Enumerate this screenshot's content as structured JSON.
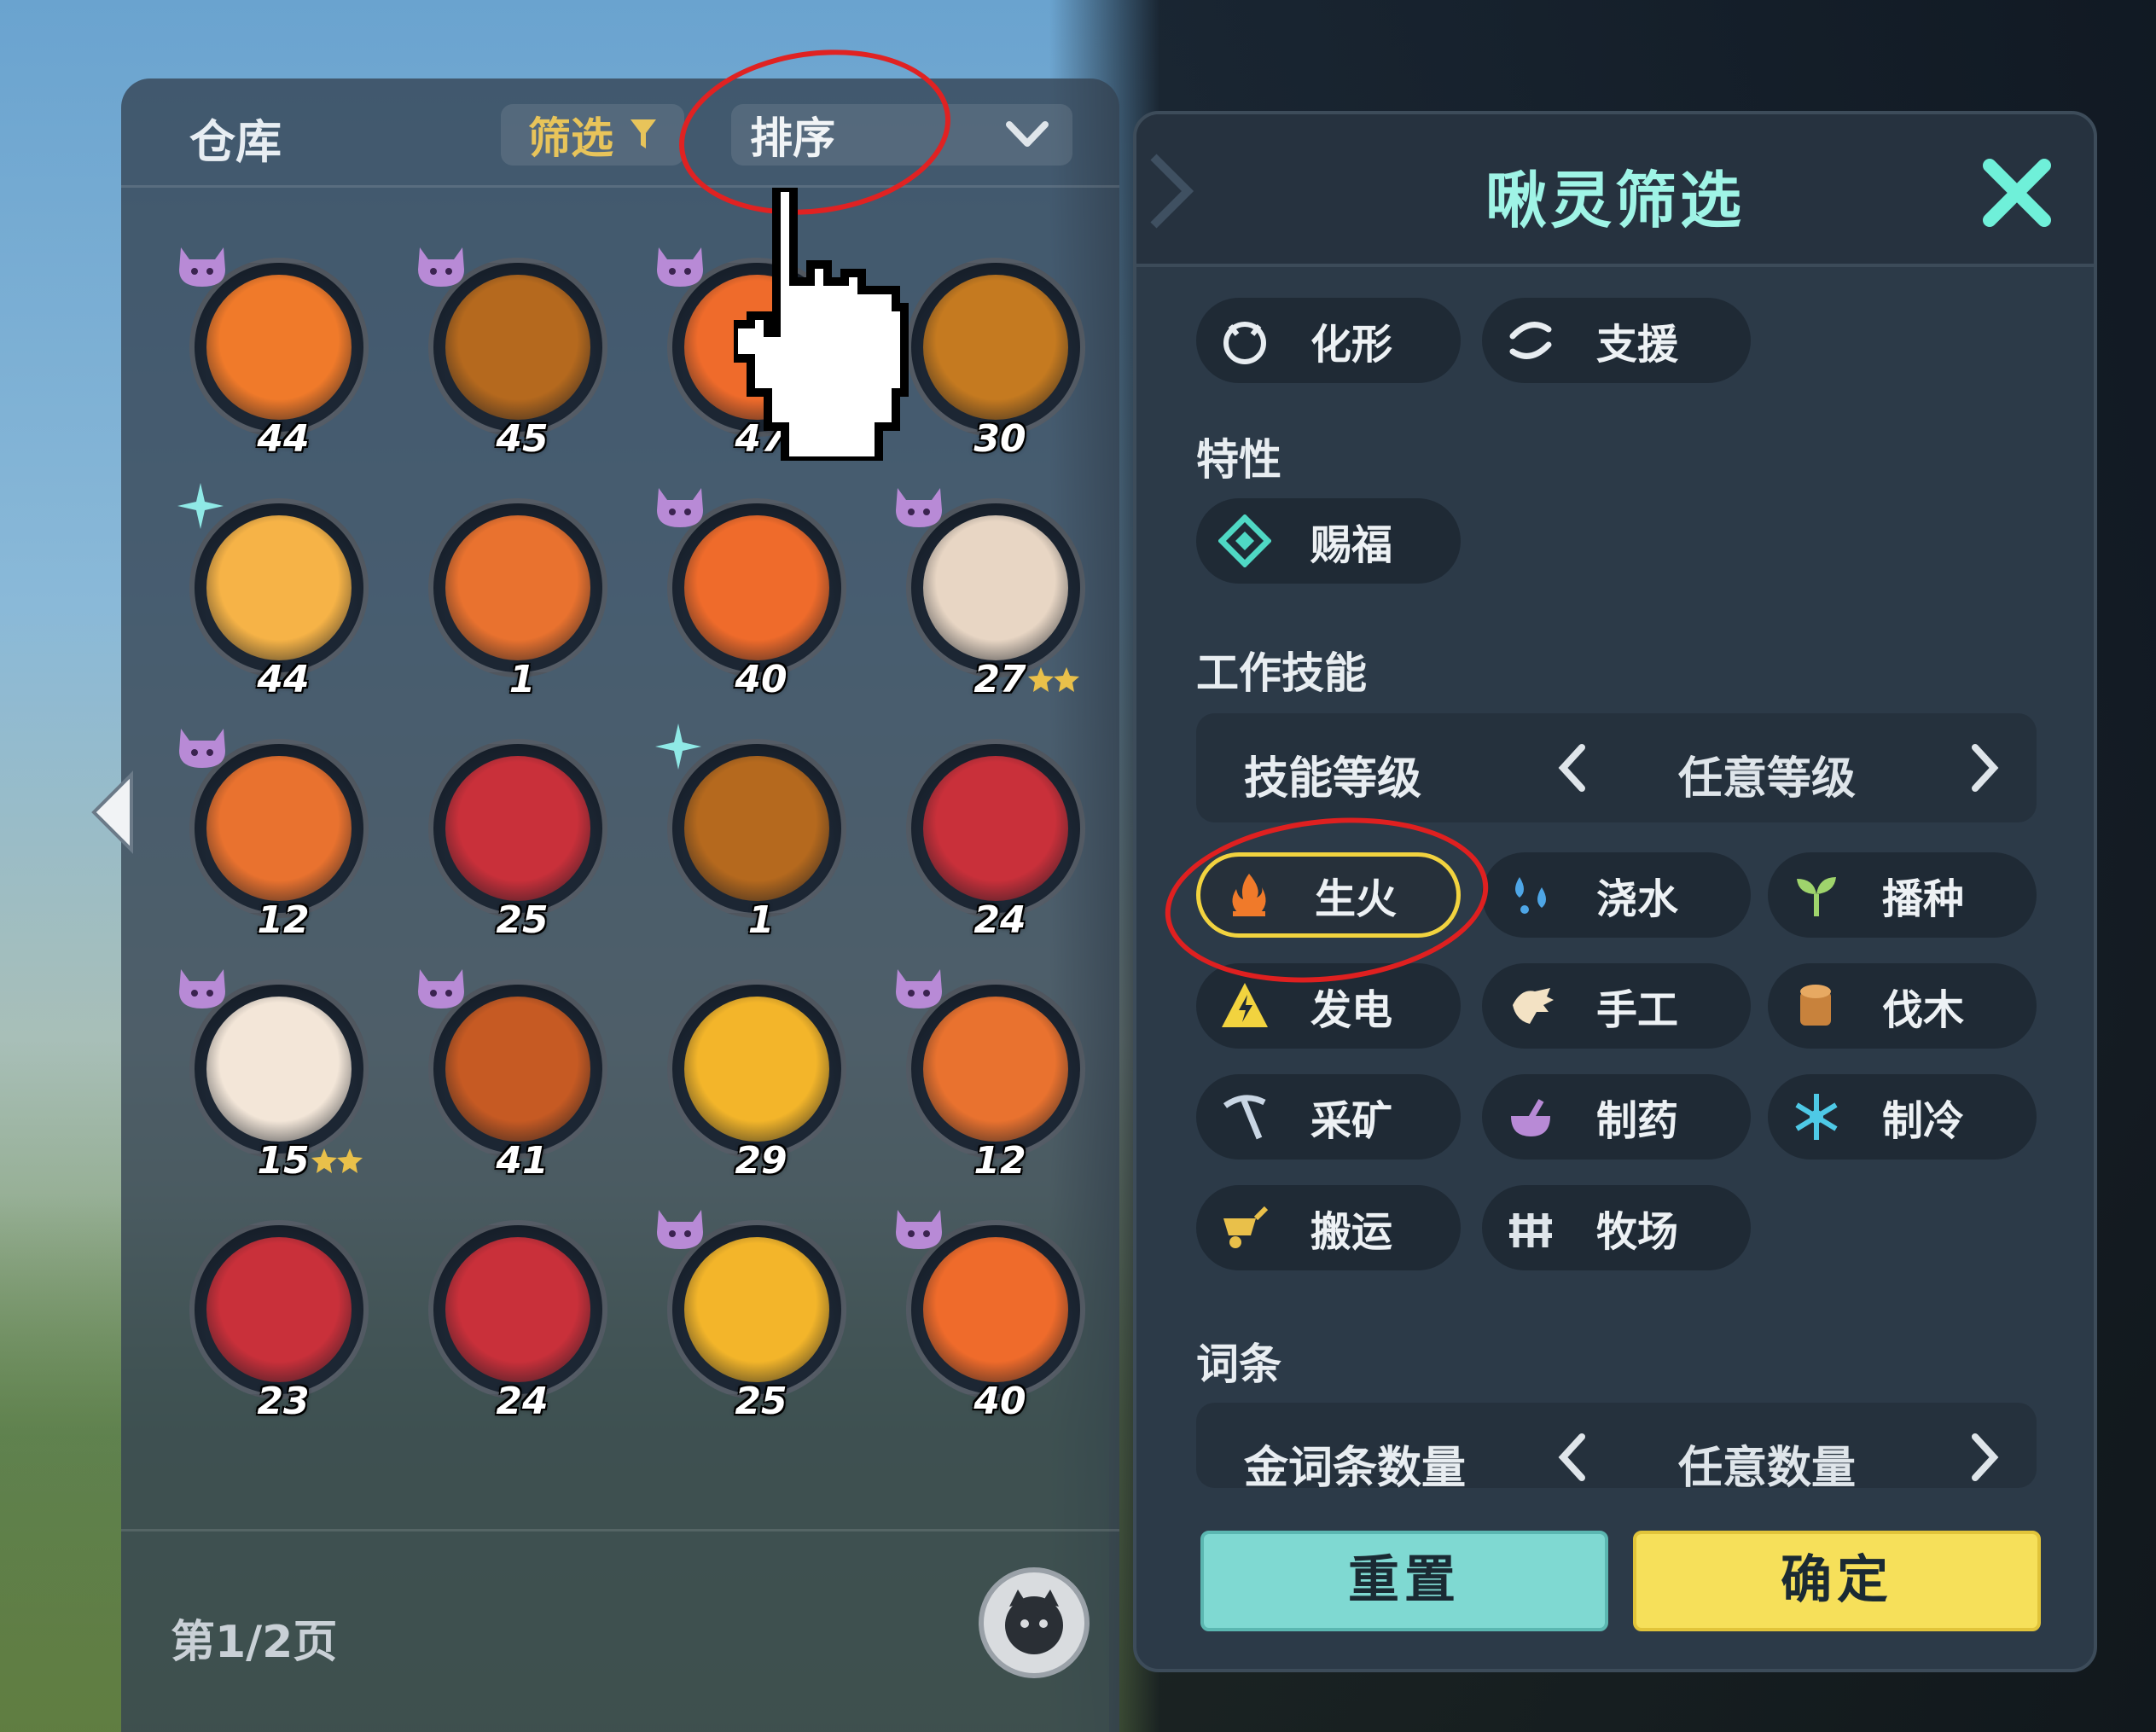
{
  "storage": {
    "title": "仓库",
    "filter_label": "筛选",
    "sort_label": "排序",
    "page_label": "第1/2页",
    "pals": [
      {
        "level": "44",
        "badge": "demon",
        "color": "#f07a2a"
      },
      {
        "level": "45",
        "badge": "demon",
        "color": "#b5691e"
      },
      {
        "level": "47",
        "badge": "demon",
        "color": "#ef6b2b",
        "stars": true
      },
      {
        "level": "30",
        "badge": "none",
        "color": "#c57a20"
      },
      {
        "level": "44",
        "badge": "spark",
        "color": "#f6b347"
      },
      {
        "level": "1",
        "badge": "none",
        "color": "#e9722f"
      },
      {
        "level": "40",
        "badge": "demon",
        "color": "#ef6b2b"
      },
      {
        "level": "27",
        "badge": "demon",
        "color": "#e8d6c4",
        "stars": true
      },
      {
        "level": "12",
        "badge": "demon",
        "color": "#e9722f"
      },
      {
        "level": "25",
        "badge": "none",
        "color": "#c9303a"
      },
      {
        "level": "1",
        "badge": "spark",
        "color": "#b5691e"
      },
      {
        "level": "24",
        "badge": "none",
        "color": "#c9303a"
      },
      {
        "level": "15",
        "badge": "demon",
        "color": "#f3e6d8",
        "stars": true
      },
      {
        "level": "41",
        "badge": "demon",
        "color": "#c65a23"
      },
      {
        "level": "29",
        "badge": "none",
        "color": "#f3b52a"
      },
      {
        "level": "12",
        "badge": "demon",
        "color": "#e9722f"
      },
      {
        "level": "23",
        "badge": "none",
        "color": "#c9303a"
      },
      {
        "level": "24",
        "badge": "none",
        "color": "#c9303a"
      },
      {
        "level": "25",
        "badge": "demon",
        "color": "#f3b52a"
      },
      {
        "level": "40",
        "badge": "demon",
        "color": "#ef6b2b"
      }
    ]
  },
  "filter_panel": {
    "title": "啾灵筛选",
    "top_chips": [
      {
        "label": "化形",
        "icon": "transform-icon"
      },
      {
        "label": "支援",
        "icon": "support-icon"
      }
    ],
    "traits_title": "特性",
    "trait_chips": [
      {
        "label": "赐福",
        "icon": "blessing-icon"
      }
    ],
    "work_title": "工作技能",
    "skill_level": {
      "label": "技能等级",
      "value": "任意等级"
    },
    "work_chips": [
      {
        "label": "生火",
        "icon": "fire-icon",
        "selected": true
      },
      {
        "label": "浇水",
        "icon": "water-icon"
      },
      {
        "label": "播种",
        "icon": "sprout-icon"
      },
      {
        "label": "发电",
        "icon": "electric-icon"
      },
      {
        "label": "手工",
        "icon": "handiwork-icon"
      },
      {
        "label": "伐木",
        "icon": "log-icon"
      },
      {
        "label": "采矿",
        "icon": "pickaxe-icon"
      },
      {
        "label": "制药",
        "icon": "medicine-icon"
      },
      {
        "label": "制冷",
        "icon": "snowflake-icon"
      },
      {
        "label": "搬运",
        "icon": "cart-icon"
      },
      {
        "label": "牧场",
        "icon": "ranch-icon"
      }
    ],
    "entries_title": "词条",
    "gold_count": {
      "label": "金词条数量",
      "value": "任意数量"
    },
    "reset_label": "重置",
    "confirm_label": "确定"
  },
  "colors": {
    "accent_title": "#9ff4e6",
    "selected_border": "#f2d33f",
    "annotation_red": "#e02222",
    "reset": "#7fd9d2",
    "confirm": "#f6e05a"
  }
}
